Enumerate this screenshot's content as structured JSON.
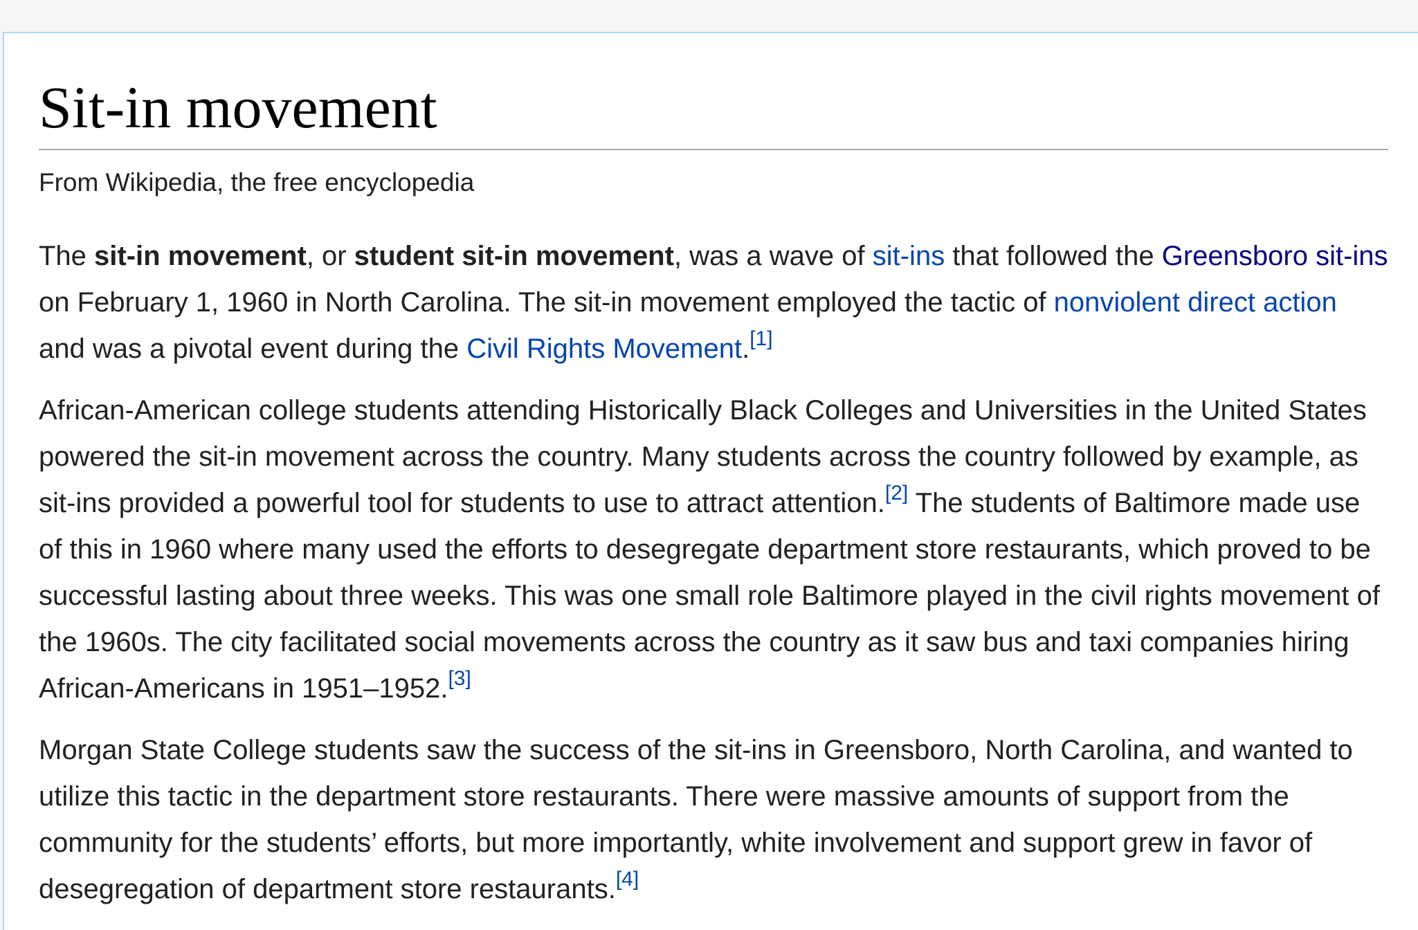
{
  "article": {
    "title": "Sit-in movement",
    "tagline": "From Wikipedia, the free encyclopedia",
    "p1": {
      "t1": "The ",
      "b1": "sit-in movement",
      "t2": ", or ",
      "b2": "student sit-in movement",
      "t3": ", was a wave of ",
      "link_sitins": "sit-ins",
      "t4": " that followed the ",
      "link_greensboro": "Greensboro sit-ins",
      "t5": " on February 1, 1960 in North Carolina. The sit-in movement employed the tactic of ",
      "link_nonviolent": "nonviolent direct action",
      "t6": " and was a pivotal event during the ",
      "link_civil_rights": "Civil Rights Movement",
      "t7": ".",
      "ref": "[1]"
    },
    "p2": {
      "t1": "African-American college students attending Historically Black Colleges and Universities in the United States powered the sit-in movement across the country. Many students across the country followed by example, as sit-ins provided a powerful tool for students to use to attract attention.",
      "ref1": "[2]",
      "t2": " The students of Baltimore made use of this in 1960 where many used the efforts to desegregate department store restaurants, which proved to be successful lasting about three weeks. This was one small role Baltimore played in the civil rights movement of the 1960s. The city facilitated social movements across the country as it saw bus and taxi companies hiring African-Americans in 1951–1952.",
      "ref2": "[3]"
    },
    "p3": {
      "t1": "Morgan State College students saw the success of the sit-ins in Greensboro, North Carolina, and wanted to utilize this tactic in the department store restaurants. There were massive amounts of support from the community for the students’ efforts, but more importantly, white involvement and support grew in favor of desegregation of department store restaurants.",
      "ref": "[4]"
    }
  },
  "colors": {
    "link": "#0645ad",
    "visited_link": "#0b0080",
    "text": "#202122",
    "border": "#a7d7f9"
  }
}
